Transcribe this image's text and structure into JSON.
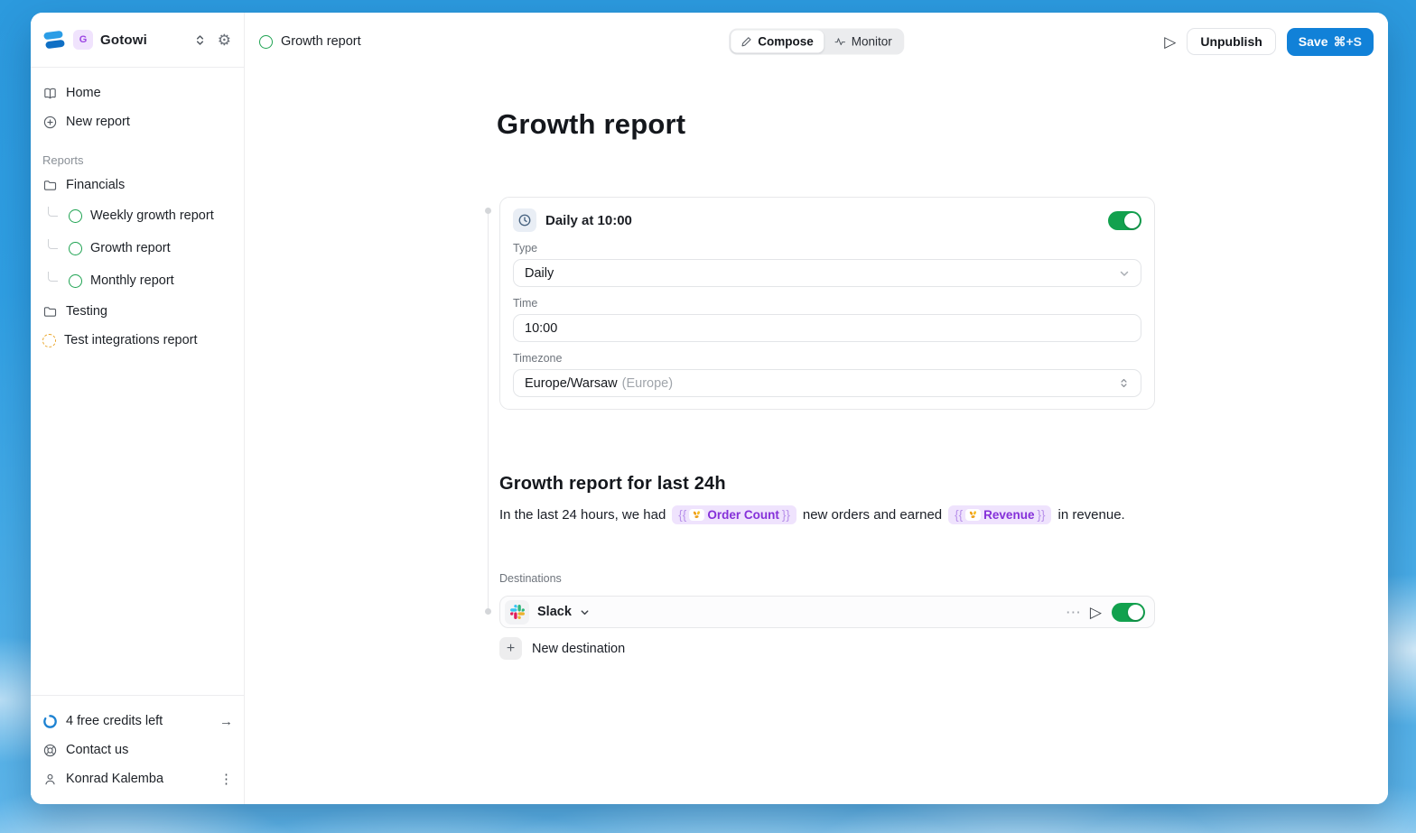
{
  "workspace": {
    "name": "Gotowi",
    "avatar_letter": "G"
  },
  "sidebar": {
    "nav": [
      {
        "label": "Home"
      },
      {
        "label": "New report"
      }
    ],
    "reports_label": "Reports",
    "items": [
      {
        "label": "Financials",
        "type": "folder"
      },
      {
        "label": "Weekly growth report",
        "status": "published"
      },
      {
        "label": "Growth report",
        "status": "published"
      },
      {
        "label": "Monthly report",
        "status": "published"
      },
      {
        "label": "Testing",
        "type": "folder"
      },
      {
        "label": "Test integrations report",
        "status": "draft"
      }
    ],
    "footer": {
      "credits_label": "4 free credits left",
      "contact_label": "Contact us",
      "user_name": "Konrad Kalemba"
    }
  },
  "topbar": {
    "title": "Growth report",
    "compose_label": "Compose",
    "monitor_label": "Monitor",
    "unpublish_label": "Unpublish",
    "save_label": "Save",
    "save_shortcut": "⌘+S"
  },
  "main": {
    "title": "Growth report",
    "schedule": {
      "header": "Daily at 10:00",
      "enabled": true,
      "type_label": "Type",
      "type_value": "Daily",
      "time_label": "Time",
      "time_value": "10:00",
      "timezone_label": "Timezone",
      "timezone_value": "Europe/Warsaw",
      "timezone_suffix": "(Europe)"
    },
    "section": {
      "heading": "Growth report for last 24h",
      "part1": "In the last 24 hours, we had",
      "token1": {
        "open": "{{",
        "label": "Order Count",
        "close": "}}"
      },
      "part2": "new orders and earned",
      "token2": {
        "open": "{{",
        "label": "Revenue",
        "close": "}}"
      },
      "part3": "in revenue."
    },
    "destinations": {
      "label": "Destinations",
      "items": [
        {
          "name": "Slack",
          "enabled": true
        }
      ],
      "new_label": "New destination"
    }
  },
  "icons": {
    "more": "⋯",
    "kebab": "⋮",
    "arrow_right": "→",
    "play": "▷",
    "plus": "+",
    "gear": "⚙"
  },
  "colors": {
    "accent_blue": "#1181d8",
    "toggle_green": "#12a14e",
    "report_green": "#1fa352",
    "draft_orange": "#e9a428",
    "token_purple_bg": "#efe3fd",
    "token_purple_text": "#8530d9",
    "sky_blue": "#2f9fe3"
  }
}
